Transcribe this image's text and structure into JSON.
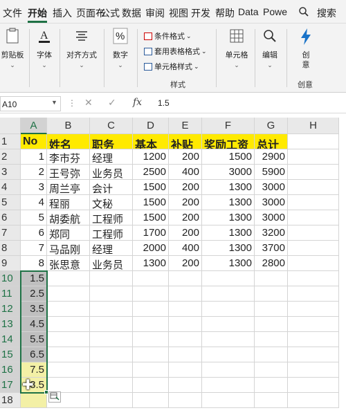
{
  "tabs": [
    "文件",
    "开始",
    "插入",
    "页面­布",
    "公式",
    "数据",
    "审阅",
    "视图",
    "开发工",
    "帮助",
    "Data",
    "Powe"
  ],
  "tab_display": [
    "文件",
    "开始",
    "插入",
    "页面布",
    "公式",
    "数据",
    "审阅",
    "视图",
    "开发",
    "帮助",
    "Data",
    "Powe"
  ],
  "search_label": "搜索",
  "ribbon": {
    "paste_label": "剪贴板",
    "font_label": "字体",
    "align_label": "对齐方式",
    "number_label": "数字",
    "conditional_format": "条件格式",
    "format_as_table": "套用表格格式",
    "cell_styles": "单元格样式",
    "styles_group": "样式",
    "cells_label": "单元格",
    "edit_label": "编辑",
    "create_label": "创意",
    "create_group": "创意",
    "font_glyph": "A",
    "number_glyph": "%"
  },
  "formula_bar": {
    "name_box": "A10",
    "fx": "fx",
    "value": "1.5"
  },
  "columns": [
    "A",
    "B",
    "C",
    "D",
    "E",
    "F",
    "G",
    "H"
  ],
  "rows": [
    "1",
    "2",
    "3",
    "4",
    "5",
    "6",
    "7",
    "8",
    "9",
    "10",
    "11",
    "12",
    "13",
    "14",
    "15",
    "16",
    "17",
    "18"
  ],
  "table": {
    "header": [
      "No",
      "姓名",
      "职务",
      "基本",
      "补贴",
      "奖励工资",
      "总计"
    ],
    "rows": [
      [
        "1",
        "李市芬",
        "经理",
        "1200",
        "200",
        "1500",
        "2900"
      ],
      [
        "2",
        "王号弥",
        "业务员",
        "2500",
        "400",
        "3000",
        "5900"
      ],
      [
        "3",
        "周兰亭",
        "会计",
        "1500",
        "200",
        "1300",
        "3000"
      ],
      [
        "4",
        "程丽",
        "文秘",
        "1500",
        "200",
        "1300",
        "3000"
      ],
      [
        "5",
        "胡委航",
        "工程师",
        "1500",
        "200",
        "1300",
        "3000"
      ],
      [
        "6",
        "郑同",
        "工程师",
        "1700",
        "200",
        "1300",
        "3200"
      ],
      [
        "7",
        "马品刚",
        "经理",
        "2000",
        "400",
        "1300",
        "3700"
      ],
      [
        "8",
        "张思意",
        "业务员",
        "1300",
        "200",
        "1300",
        "2800"
      ]
    ],
    "selection_values": [
      "1.5",
      "2.5",
      "3.5",
      "4.5",
      "5.5",
      "6.5",
      "7.5",
      "8.5"
    ]
  }
}
